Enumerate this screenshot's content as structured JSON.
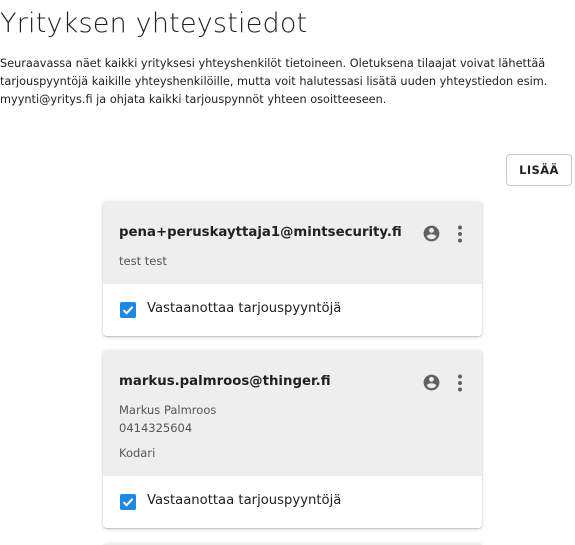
{
  "header": {
    "title": "Yrityksen yhteystiedot",
    "description": "Seuraavassa näet kaikki yrityksesi yhteyshenkilöt tietoineen. Oletuksena tilaajat voivat lähettää tarjouspyyntöjä kaikille yhteyshenkilöille, mutta voit halutessasi lisätä uuden yhteystiedon esim. myynti@yritys.fi ja ohjata kaikki tarjouspynnöt yhteen osoitteeseen."
  },
  "actions": {
    "add_label": "LISÄÄ"
  },
  "contacts": [
    {
      "email": "pena+peruskayttaja1@mintsecurity.fi",
      "name": "test test",
      "phone": "",
      "title": "",
      "receives_requests": true,
      "receives_label": "Vastaanottaa tarjouspyyntöjä"
    },
    {
      "email": "markus.palmroos@thinger.fi",
      "name": "Markus Palmroos",
      "phone": "0414325604",
      "title": "Kodari",
      "receives_requests": true,
      "receives_label": "Vastaanottaa tarjouspyyntöjä"
    }
  ],
  "icons": {
    "account": "account-circle-icon",
    "more": "more-vert-icon",
    "checkbox": "checkbox-checked-icon"
  },
  "colors": {
    "accent": "#1e88e5",
    "card_header_bg": "#eeeeee",
    "icon": "#616161"
  }
}
